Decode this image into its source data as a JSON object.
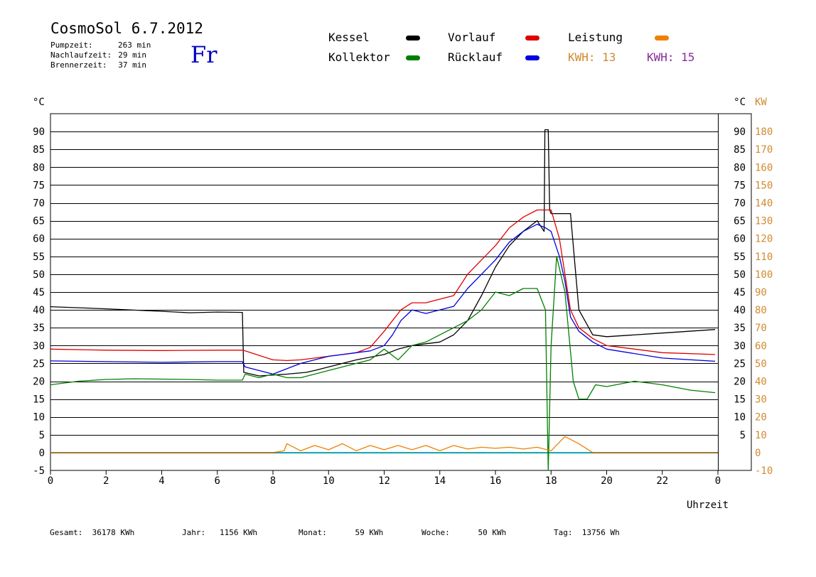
{
  "header": {
    "title": "CosmoSol 6.7.2012",
    "day": "Fr",
    "info": [
      {
        "key": "Pumpzeit:",
        "value": "263 min"
      },
      {
        "key": "Nachlaufzeit:",
        "value": "29 min"
      },
      {
        "key": "Brennerzeit:",
        "value": "37 min"
      }
    ]
  },
  "legend": {
    "items": [
      {
        "label": "Kessel",
        "color": "#000000"
      },
      {
        "label": "Vorlauf",
        "color": "#e00000"
      },
      {
        "label": "Leistung",
        "color": "#f08000"
      },
      {
        "label": "Kollektor",
        "color": "#008000"
      },
      {
        "label": "Rücklauf",
        "color": "#0000e0"
      }
    ],
    "kwh": [
      {
        "label": "KWH:",
        "value": "13",
        "color": "#d08a30"
      },
      {
        "label": "KWH:",
        "value": "15",
        "color": "#8a2a9a"
      }
    ]
  },
  "footer": {
    "gesamt_label": "Gesamt:",
    "gesamt_value": "36178 KWh",
    "jahr_label": "Jahr:",
    "jahr_value": "1156 KWh",
    "monat_label": "Monat:",
    "monat_value": "59 KWh",
    "woche_label": "Woche:",
    "woche_value": "50 KWh",
    "tag_label": "Tag:",
    "tag_value": "13756 Wh"
  },
  "chart_data": {
    "type": "line",
    "xlabel": "Uhrzeit",
    "ylabel_left": "°C",
    "ylabel_right_1": "°C",
    "ylabel_right_2": "KW",
    "xlim": [
      0,
      24
    ],
    "ylim": [
      -5,
      95
    ],
    "x_ticks": [
      0,
      2,
      4,
      6,
      8,
      10,
      12,
      14,
      16,
      18,
      20,
      22,
      0
    ],
    "y_ticks_left": [
      -5,
      0,
      5,
      10,
      15,
      20,
      25,
      30,
      35,
      40,
      45,
      50,
      55,
      60,
      65,
      70,
      75,
      80,
      85,
      90
    ],
    "y_ticks_right_c": [
      5,
      10,
      15,
      20,
      25,
      30,
      35,
      40,
      45,
      50,
      55,
      60,
      65,
      70,
      75,
      80,
      85,
      90
    ],
    "y_ticks_right_kw": [
      -10,
      0,
      10,
      20,
      30,
      40,
      50,
      60,
      70,
      80,
      90,
      100,
      110,
      120,
      130,
      140,
      150,
      160,
      170,
      180
    ],
    "grid": true,
    "series": [
      {
        "name": "Kessel",
        "color": "#000000",
        "x": [
          0,
          2,
          4,
          5,
          6,
          6.9,
          6.95,
          7.5,
          8.5,
          9.2,
          9.5,
          10,
          11,
          12,
          12.5,
          13,
          14,
          14.5,
          15,
          15.5,
          16,
          16.5,
          17,
          17.5,
          17.75,
          17.78,
          17.9,
          17.95,
          18,
          18.7,
          19,
          19.5,
          20,
          22,
          23.9
        ],
        "y": [
          40.9,
          40.3,
          39.6,
          39.2,
          39.4,
          39.3,
          22.5,
          21.5,
          22,
          22.5,
          23,
          24,
          26,
          27.5,
          29,
          30,
          31,
          33,
          37,
          44,
          52,
          58,
          62,
          65,
          62,
          90.5,
          90.5,
          68,
          67,
          67,
          40,
          33,
          32.5,
          33.5,
          34.5
        ]
      },
      {
        "name": "Vorlauf",
        "color": "#e00000",
        "x": [
          0,
          2,
          4,
          6,
          6.9,
          7,
          8,
          8.5,
          9,
          9.5,
          10,
          10.5,
          11,
          11.5,
          12,
          12.3,
          12.6,
          13,
          13.5,
          14,
          14.5,
          15,
          15.5,
          16,
          16.5,
          17,
          17.5,
          17.8,
          18,
          18.3,
          18.5,
          18.7,
          19,
          19.5,
          20,
          22,
          23.9
        ],
        "y": [
          29,
          28.7,
          28.6,
          28.7,
          28.7,
          28.5,
          26,
          25.8,
          26,
          26.5,
          27,
          27.5,
          28,
          29.5,
          34,
          37,
          40,
          42,
          42,
          43,
          44,
          50,
          54,
          58,
          63,
          66,
          68,
          68,
          68,
          60,
          50,
          40,
          35,
          32,
          30,
          28,
          27.5
        ]
      },
      {
        "name": "Rücklauf",
        "color": "#0000e0",
        "x": [
          0,
          2,
          4,
          6,
          6.9,
          7,
          8,
          8.5,
          9,
          9.5,
          10,
          10.5,
          11,
          11.5,
          12,
          12.3,
          12.6,
          13,
          13.5,
          14,
          14.5,
          15,
          15.5,
          16,
          16.5,
          17,
          17.5,
          17.8,
          18,
          18.3,
          18.5,
          18.7,
          19,
          19.5,
          20,
          22,
          23.9
        ],
        "y": [
          25.7,
          25.5,
          25.3,
          25.5,
          25.5,
          24,
          22,
          23.5,
          25,
          26,
          27,
          27.5,
          28,
          28.5,
          30,
          33,
          37,
          40,
          39,
          40,
          41,
          46,
          50,
          54,
          59,
          62,
          64,
          63,
          62,
          55,
          48,
          38,
          34,
          31,
          29,
          26.5,
          25.6
        ]
      },
      {
        "name": "Kollektor",
        "color": "#008000",
        "x": [
          0,
          1,
          2,
          3,
          4,
          5,
          6,
          6.9,
          7,
          7.5,
          8,
          8.5,
          9,
          9.5,
          10,
          10.5,
          11,
          11.5,
          12,
          12.5,
          13,
          13.5,
          14,
          14.5,
          15,
          15.5,
          16,
          16.5,
          17,
          17.5,
          17.8,
          17.9,
          18,
          18.2,
          18.5,
          18.8,
          19,
          19.3,
          19.6,
          20,
          21,
          22,
          23,
          23.9
        ],
        "y": [
          19,
          20,
          20.5,
          20.7,
          20.6,
          20.5,
          20.3,
          20.3,
          22,
          21,
          22,
          21,
          21,
          22,
          23,
          24,
          25,
          26,
          29,
          26,
          30,
          31,
          33,
          35,
          37,
          40,
          45,
          44,
          46,
          46,
          40,
          -5,
          30,
          55,
          45,
          20,
          15,
          15,
          19,
          18.5,
          20,
          19,
          17.5,
          16.8
        ]
      },
      {
        "name": "Leistung",
        "color": "#f08000",
        "x": [
          0,
          8,
          8.4,
          8.5,
          9,
          9.5,
          10,
          10.5,
          11,
          11.5,
          12,
          12.5,
          13,
          13.5,
          14,
          14.5,
          15,
          15.5,
          16,
          16.5,
          17,
          17.5,
          18,
          18.5,
          19,
          19.4,
          19.5,
          24
        ],
        "y": [
          0,
          0,
          0.5,
          2.5,
          0.5,
          2,
          0.8,
          2.5,
          0.5,
          2,
          0.8,
          2,
          0.8,
          2,
          0.5,
          2,
          1,
          1.5,
          1.2,
          1.5,
          1,
          1.5,
          0.5,
          4.5,
          2.5,
          0.5,
          0,
          0
        ]
      }
    ]
  }
}
